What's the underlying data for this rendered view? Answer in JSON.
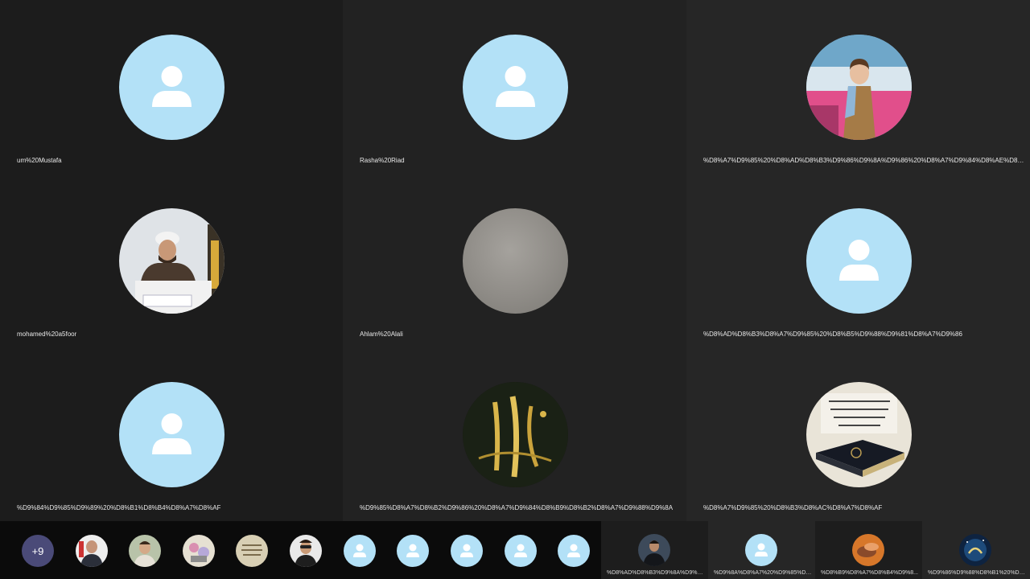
{
  "participants": [
    {
      "name": "um%20Mustafa",
      "avatar": "default-avatar"
    },
    {
      "name": "Rasha%20Riad",
      "avatar": "default-avatar"
    },
    {
      "name": "%D8%A7%D9%85%20%D8%AD%D8%B3%D9%86%D9%8A%D9%86%20%D8%A7%D9%84%D8%AE%D8%A7%D...",
      "avatar": "photo-girl"
    },
    {
      "name": "mohamed%20a5foor",
      "avatar": "photo-man-desk"
    },
    {
      "name": "Ahlam%20Alali",
      "avatar": "photo-blurred"
    },
    {
      "name": "%D8%AD%D8%B3%D8%A7%D9%85%20%D8%B5%D9%88%D9%81%D8%A7%D9%86",
      "avatar": "default-avatar"
    },
    {
      "name": "%D9%84%D9%85%D9%89%20%D8%B1%D8%B4%D8%A7%D8%AF",
      "avatar": "default-avatar"
    },
    {
      "name": "%D9%85%D8%A7%D8%B2%D9%86%20%D8%A7%D9%84%D8%B9%D8%B2%D8%A7%D9%88%D9%8A",
      "avatar": "photo-calligraphy"
    },
    {
      "name": "%D8%A7%D9%85%20%D8%B3%D8%AC%D8%A7%D8%AF",
      "avatar": "photo-quran-book"
    }
  ],
  "strip": {
    "more_count": "+9",
    "avatars": [
      "photo-man-suit",
      "photo-young-man",
      "photo-flowers",
      "photo-text-card",
      "photo-man-sunglasses",
      "default-avatar",
      "default-avatar",
      "default-avatar",
      "default-avatar",
      "default-avatar"
    ]
  },
  "cameras": [
    {
      "name": "%D8%AD%D8%B3%D9%8A%D9%8...",
      "avatar": "photo-man-dark"
    },
    {
      "name": "%D9%8A%D8%A7%20%D9%85%D8...",
      "avatar": "default-avatar"
    },
    {
      "name": "%D8%B9%D8%A7%D8%B4%D9%8...",
      "avatar": "photo-hands-orange"
    },
    {
      "name": "%D9%86%D9%88%D8%B1%20%D9...",
      "avatar": "photo-night-calligraphy"
    }
  ],
  "colors": {
    "placeholder_bg": "#b3e1f7",
    "placeholder_fg": "#ffffff",
    "more_bg": "#4a4a78"
  }
}
